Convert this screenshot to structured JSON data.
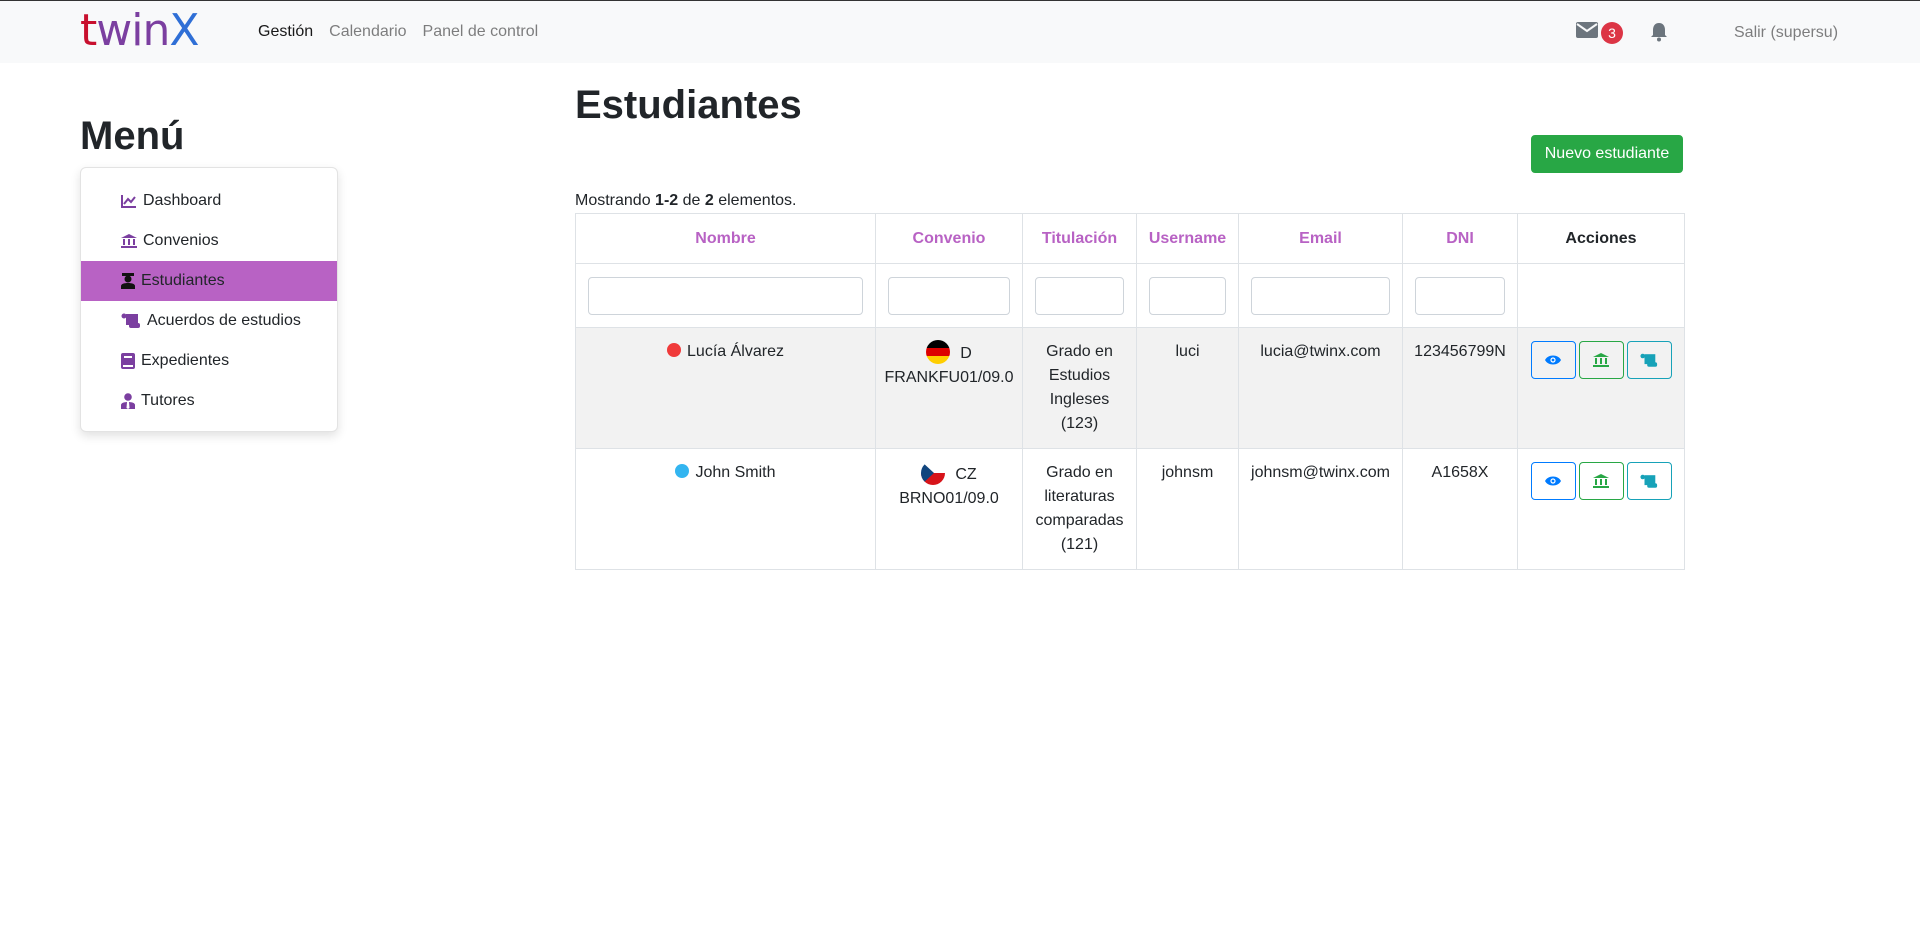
{
  "brand": {
    "part1": "t",
    "part2": "win",
    "part3": "X"
  },
  "nav": {
    "links": [
      "Gestión",
      "Calendario",
      "Panel de control"
    ],
    "mail_count": "3",
    "logout": "Salir (supersu)"
  },
  "sidebar": {
    "title": "Menú",
    "items": [
      {
        "label": "Dashboard",
        "icon": "chart-line-icon"
      },
      {
        "label": "Convenios",
        "icon": "university-icon"
      },
      {
        "label": "Estudiantes",
        "icon": "graduate-icon"
      },
      {
        "label": "Acuerdos de estudios",
        "icon": "scroll-icon"
      },
      {
        "label": "Expedientes",
        "icon": "book-icon"
      },
      {
        "label": "Tutores",
        "icon": "user-tie-icon"
      }
    ],
    "active_index": 2
  },
  "main": {
    "title": "Estudiantes",
    "new_button": "Nuevo estudiante",
    "summary": {
      "prefix": "Mostrando ",
      "range": "1-2",
      "mid": " de ",
      "total": "2",
      "suffix": " elementos."
    },
    "columns": [
      "Nombre",
      "Convenio",
      "Titulación",
      "Username",
      "Email",
      "DNI",
      "Acciones"
    ],
    "rows": [
      {
        "status_color": "#f03a3a",
        "name": "Lucía Álvarez",
        "flag": "de",
        "convenio_code": "D",
        "convenio": "FRANKFU01/09.0",
        "titulacion": "Grado en Estudios Ingleses (123)",
        "username": "luci",
        "email": "lucia@twinx.com",
        "dni": "123456799N"
      },
      {
        "status_color": "#33b5f0",
        "name": "John Smith",
        "flag": "cz",
        "convenio_code": "CZ",
        "convenio": "BRNO01/09.0",
        "titulacion": "Grado en literaturas comparadas (121)",
        "username": "johnsm",
        "email": "johnsm@twinx.com",
        "dni": "A1658X"
      }
    ]
  },
  "colors": {
    "accent": "#b862c4",
    "success": "#28a745",
    "primary": "#007bff",
    "info": "#17a2b8",
    "danger": "#dc3545"
  }
}
